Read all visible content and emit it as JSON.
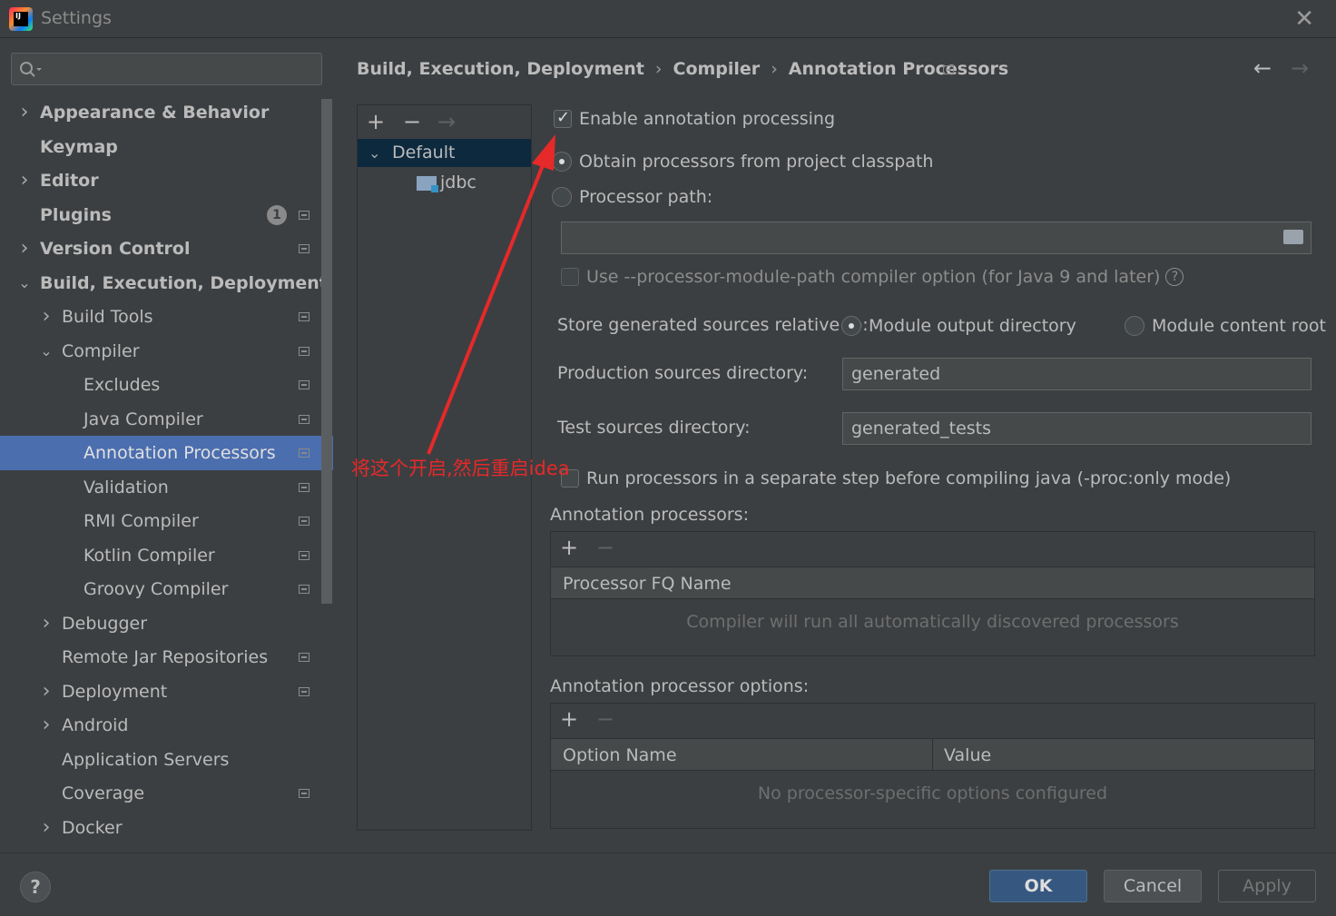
{
  "window": {
    "title": "Settings",
    "close": "✕"
  },
  "search": {
    "placeholder": "",
    "value": ""
  },
  "sidebar": {
    "items": [
      {
        "label": "Appearance & Behavior",
        "level": 0,
        "expandable": true,
        "expanded": false,
        "bold": true
      },
      {
        "label": "Keymap",
        "level": 0,
        "bold": true
      },
      {
        "label": "Editor",
        "level": 0,
        "expandable": true,
        "expanded": false,
        "bold": true
      },
      {
        "label": "Plugins",
        "level": 0,
        "bold": true,
        "badge": "1",
        "project": true
      },
      {
        "label": "Version Control",
        "level": 0,
        "expandable": true,
        "expanded": false,
        "bold": true,
        "project": true
      },
      {
        "label": "Build, Execution, Deployment",
        "level": 0,
        "expandable": true,
        "expanded": true,
        "bold": true
      },
      {
        "label": "Build Tools",
        "level": 1,
        "expandable": true,
        "expanded": false,
        "project": true
      },
      {
        "label": "Compiler",
        "level": 1,
        "expandable": true,
        "expanded": true,
        "project": true
      },
      {
        "label": "Excludes",
        "level": 2,
        "project": true
      },
      {
        "label": "Java Compiler",
        "level": 2,
        "project": true
      },
      {
        "label": "Annotation Processors",
        "level": 2,
        "project": true,
        "selected": true
      },
      {
        "label": "Validation",
        "level": 2,
        "project": true
      },
      {
        "label": "RMI Compiler",
        "level": 2,
        "project": true
      },
      {
        "label": "Kotlin Compiler",
        "level": 2,
        "project": true
      },
      {
        "label": "Groovy Compiler",
        "level": 2,
        "project": true
      },
      {
        "label": "Debugger",
        "level": 1,
        "expandable": true,
        "expanded": false
      },
      {
        "label": "Remote Jar Repositories",
        "level": 1,
        "project": true
      },
      {
        "label": "Deployment",
        "level": 1,
        "expandable": true,
        "expanded": false,
        "project": true
      },
      {
        "label": "Android",
        "level": 1,
        "expandable": true,
        "expanded": false
      },
      {
        "label": "Application Servers",
        "level": 1
      },
      {
        "label": "Coverage",
        "level": 1,
        "project": true
      },
      {
        "label": "Docker",
        "level": 1,
        "expandable": true,
        "expanded": false
      }
    ]
  },
  "breadcrumb": {
    "part1": "Build, Execution, Deployment",
    "part2": "Compiler",
    "part3": "Annotation Processors",
    "sep": "›"
  },
  "profiles": {
    "default": "Default",
    "module": "jdbc"
  },
  "options": {
    "enable_label": "Enable annotation processing",
    "enable_checked": true,
    "obtain_classpath": "Obtain processors from project classpath",
    "processor_path": "Processor path:",
    "processor_path_value": "",
    "module_path_option": "Use --processor-module-path compiler option (for Java 9 and later)",
    "store_label": "Store generated sources relative to:",
    "module_output": "Module output directory",
    "module_content": "Module content root",
    "production_label": "Production sources directory:",
    "production_value": "generated",
    "test_label": "Test sources directory:",
    "test_value": "generated_tests",
    "run_separate": "Run processors in a separate step before compiling java (-proc:only mode)"
  },
  "processors_table": {
    "title": "Annotation processors:",
    "column": "Processor FQ Name",
    "empty": "Compiler will run all automatically discovered processors"
  },
  "options_table": {
    "title": "Annotation processor options:",
    "col_name": "Option Name",
    "col_value": "Value",
    "empty": "No processor-specific options configured"
  },
  "annotation": {
    "text": "将这个开启,然后重启idea",
    "color": "#e62929"
  },
  "footer": {
    "ok": "OK",
    "cancel": "Cancel",
    "apply": "Apply",
    "help": "?"
  }
}
